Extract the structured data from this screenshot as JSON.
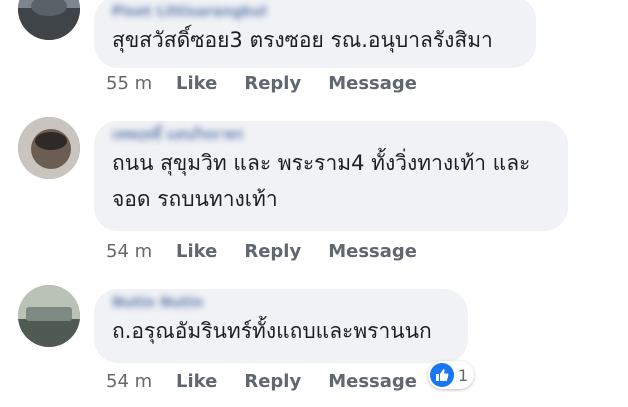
{
  "comments": [
    {
      "author": "Piset Littisarangkul",
      "text_lines": [
        "สุขสวัสดิ์ซอย3 ตรงซอย รณ.อนุบาลรังสิมา"
      ],
      "time": "55 m",
      "actions": [
        "Like",
        "Reply",
        "Message"
      ]
    },
    {
      "author": "เทพฤทธิ์ แสนกิจจาพร",
      "text_lines": [
        "ถนน สุขุมวิท และ พระราม4 ทั้งวิ่งทางเท้า และ",
        "จอด รถบนทางเท้า"
      ],
      "time": "54 m",
      "actions": [
        "Like",
        "Reply",
        "Message"
      ]
    },
    {
      "author": "Nutin Nutin",
      "text_lines": [
        "ถ.อรุณอัมรินทร์ทั้งแถบและพรานนก"
      ],
      "time": "54 m",
      "actions": [
        "Like",
        "Reply",
        "Message"
      ],
      "reaction": {
        "icon": "thumbs-up-icon",
        "count": "1"
      }
    }
  ],
  "colors": {
    "bubble": "#f0f2f5",
    "text": "#1c1e21",
    "meta": "#65676b",
    "like_blue": "#1877f2"
  }
}
